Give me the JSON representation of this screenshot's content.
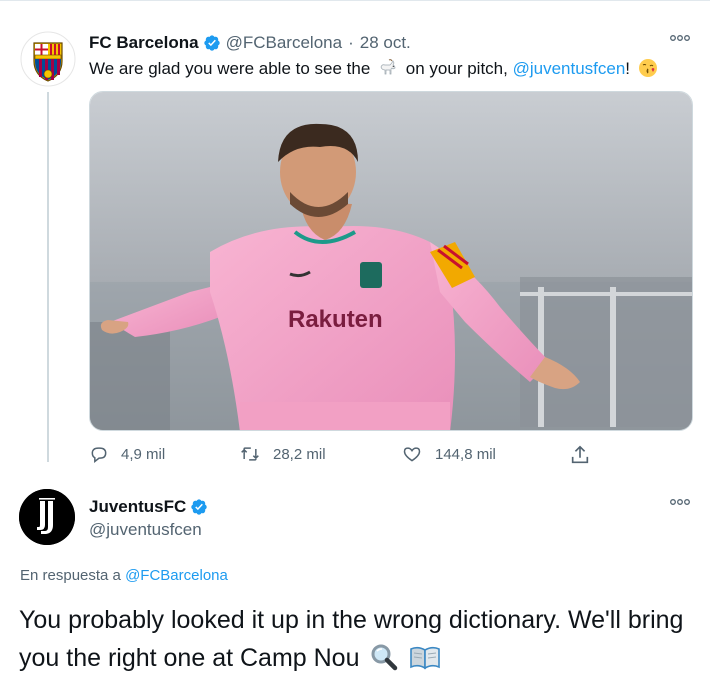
{
  "tweet1": {
    "author_name": "FC Barcelona",
    "author_handle": "@FCBarcelona",
    "separator": "·",
    "date": "28 oct.",
    "text_part1": "We are glad you were able to see the",
    "text_emoji1": "goat-emoji",
    "text_part2": "on your pitch,",
    "text_mention": "@juventusfcen",
    "text_part3": "!",
    "text_emoji2": "kissing-face-emoji",
    "media": {
      "description": "football-player-photo",
      "shirt_text": "Rakuten"
    },
    "stats": {
      "replies": "4,9 mil",
      "retweets": "28,2 mil",
      "likes": "144,8 mil"
    }
  },
  "tweet2": {
    "author_name": "JuventusFC",
    "author_handle": "@juventusfcen",
    "reply_label": "En respuesta a",
    "reply_to": "@FCBarcelona",
    "text": "You probably looked it up in the wrong dictionary. We'll bring you the right one at Camp Nou",
    "emojis": [
      "magnifying-glass-emoji",
      "open-book-emoji"
    ]
  },
  "colors": {
    "accent": "#1d9bf0",
    "muted": "#536471",
    "text": "#0f1419",
    "barca_blue": "#004d98",
    "barca_red": "#a50044",
    "shirt_pink": "#f7a6c9"
  }
}
